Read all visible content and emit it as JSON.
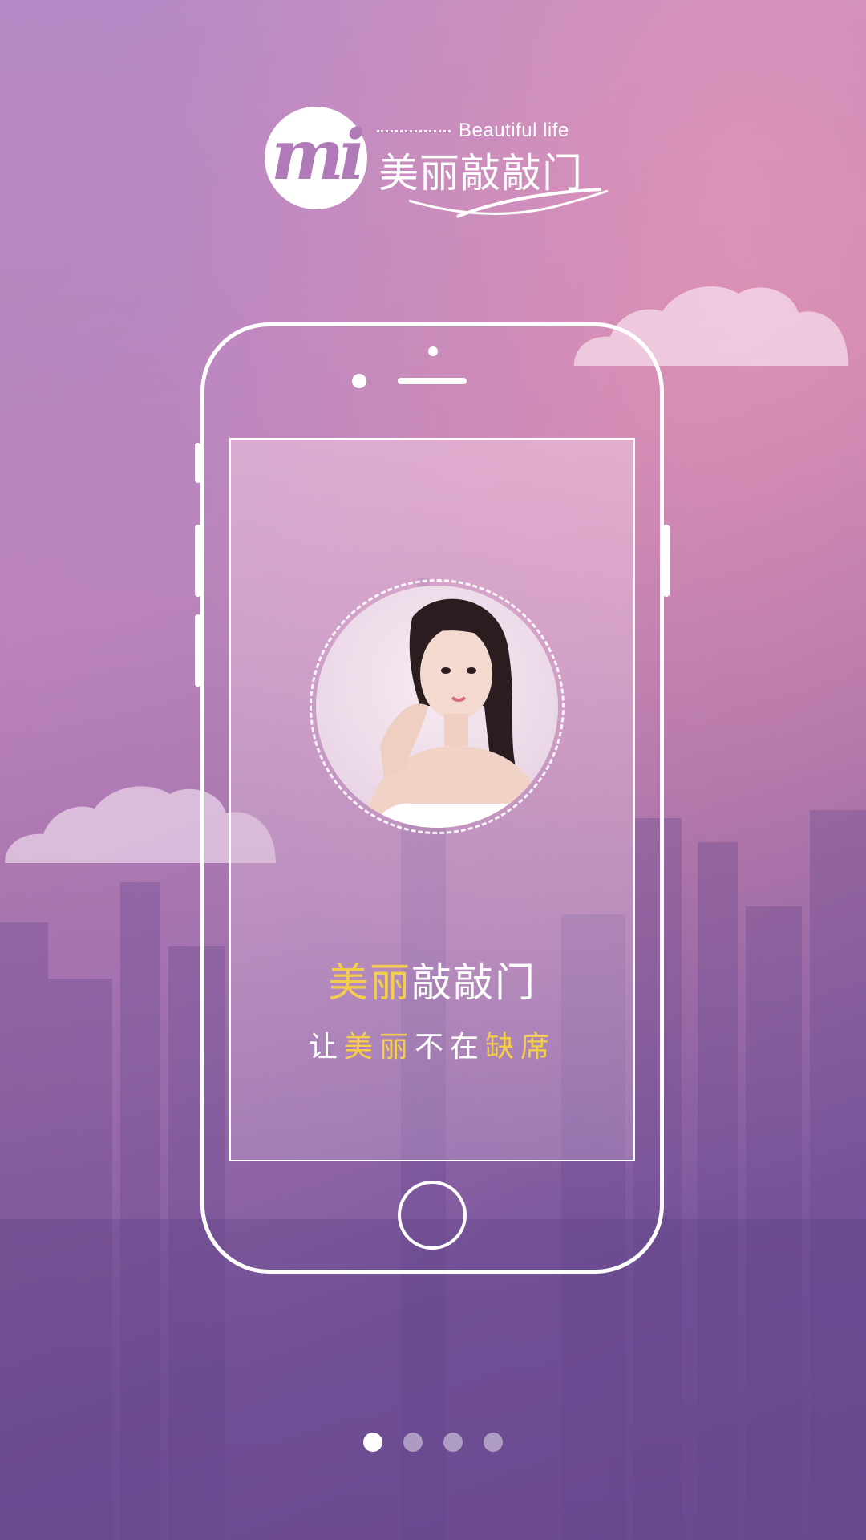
{
  "brand": {
    "tagline": "Beautiful life",
    "name": "美丽敲敲门",
    "logo_letters": "mi"
  },
  "screen": {
    "title_highlight": "美丽",
    "title_rest": "敲敲门",
    "slogan_parts": [
      "让",
      "美",
      "丽",
      "不",
      "在",
      "缺",
      "席"
    ]
  },
  "pager": {
    "count": 4,
    "active_index": 0
  },
  "colors": {
    "accent": "#f5cd4c",
    "white": "#ffffff",
    "logo_mark": "#b07ab8"
  },
  "icons": {
    "logo": "mi-logo-icon",
    "home_button": "phone-home-button-icon"
  }
}
